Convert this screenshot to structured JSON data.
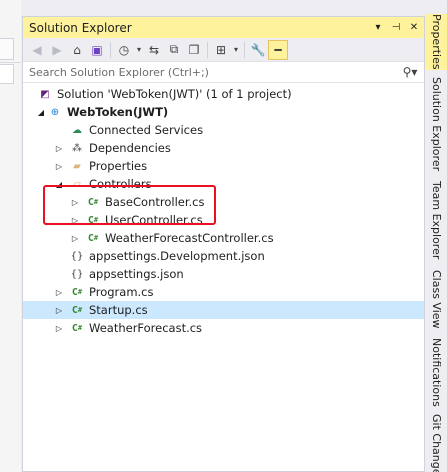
{
  "panel": {
    "title": "Solution Explorer",
    "title_buttons": [
      "▾",
      "⊣",
      "✕"
    ]
  },
  "toolbar": {
    "icons": [
      "back-icon",
      "forward-icon",
      "home-icon",
      "switch-views-icon",
      "history-icon",
      "sync-icon",
      "collapse-all-icon",
      "show-all-files-icon",
      "preview-icon",
      "properties-icon",
      "pin-icon"
    ]
  },
  "search": {
    "placeholder": "Search Solution Explorer (Ctrl+;)"
  },
  "tree": {
    "solution": "Solution 'WebToken(JWT)' (1 of 1 project)",
    "project": "WebToken(JWT)",
    "connected": "Connected Services",
    "dependencies": "Dependencies",
    "properties": "Properties",
    "controllers": "Controllers",
    "base_controller": "BaseController.cs",
    "user_controller": "UserController.cs",
    "weather_controller": "WeatherForecastController.cs",
    "appsettings_dev": "appsettings.Development.json",
    "appsettings": "appsettings.json",
    "program": "Program.cs",
    "startup": "Startup.cs",
    "weather": "WeatherForecast.cs"
  },
  "right_tabs": {
    "properties": "Properties",
    "solution_explorer": "Solution Explorer",
    "team_explorer": "Team Explorer",
    "class_view": "Class View",
    "notifications": "Notifications",
    "git_changes": "Git Changes"
  },
  "colors": {
    "accent": "#fff29d",
    "selection": "#cce8ff",
    "highlight": "#e81123",
    "csharp": "#368832"
  }
}
